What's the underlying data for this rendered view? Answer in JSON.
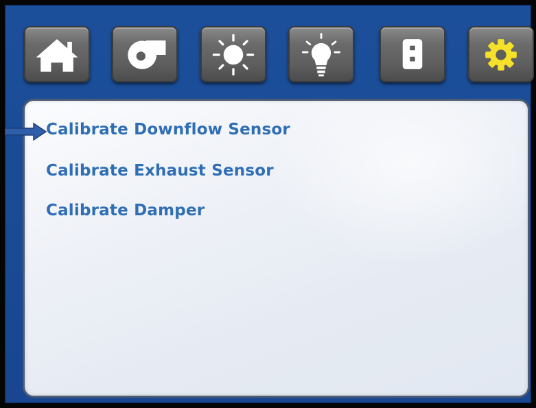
{
  "toolbar": {
    "buttons": [
      {
        "id": "home",
        "icon": "home-icon"
      },
      {
        "id": "fan",
        "icon": "blower-fan-icon"
      },
      {
        "id": "light",
        "icon": "sun-icon"
      },
      {
        "id": "lamp",
        "icon": "lightbulb-icon"
      },
      {
        "id": "outlet",
        "icon": "power-outlet-icon"
      },
      {
        "id": "settings",
        "icon": "gear-icon",
        "active": true
      }
    ]
  },
  "menu": {
    "items": [
      {
        "label": "Calibrate Downflow Sensor",
        "selected": true
      },
      {
        "label": "Calibrate Exhaust Sensor",
        "selected": false
      },
      {
        "label": "Calibrate Damper",
        "selected": false
      }
    ]
  },
  "colors": {
    "background_blue": "#1c4f9a",
    "menu_text": "#2f6eb4",
    "active_icon": "#f5e12a",
    "icon_white": "#ffffff",
    "tile_gray": "#6b6b6b"
  }
}
